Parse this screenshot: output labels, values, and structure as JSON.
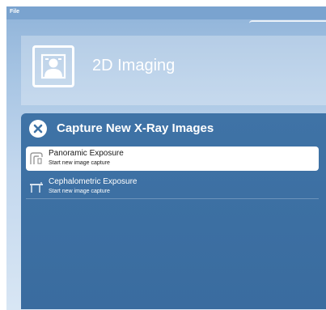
{
  "menu": {
    "file_label": "File"
  },
  "header": {
    "title": "2D Imaging",
    "icon": "patient-portrait-icon"
  },
  "panel": {
    "title": "Capture New X-Ray Images",
    "close_icon": "close-icon",
    "items": [
      {
        "title": "Panoramic Exposure",
        "subtitle": "Start new image capture",
        "icon": "panoramic-unit-icon",
        "selected": true
      },
      {
        "title": "Cephalometric Exposure",
        "subtitle": "Start new image capture",
        "icon": "cephalometric-unit-icon",
        "selected": false
      }
    ]
  },
  "colors": {
    "panel_background": "#3f73a6",
    "selected_background": "#ffffff",
    "header_text": "#ffffff"
  }
}
